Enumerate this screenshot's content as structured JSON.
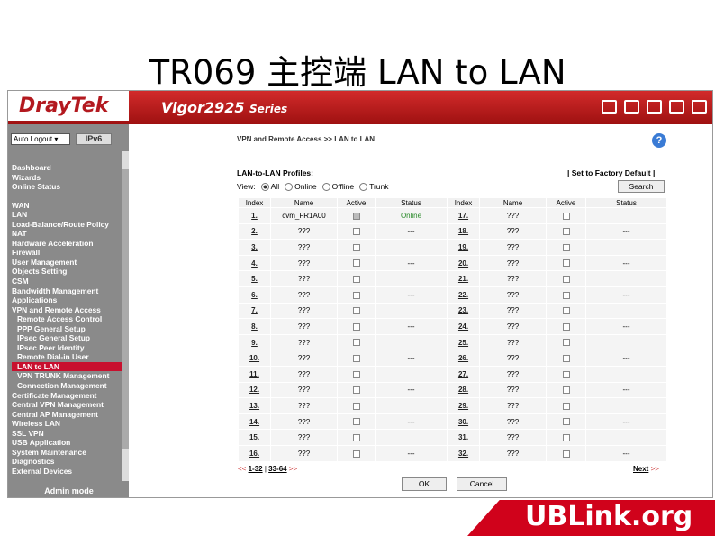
{
  "slide": {
    "title": "TR069 主控端 LAN to LAN"
  },
  "header": {
    "logo": "DrayTek",
    "model": "Vigor2925",
    "series": "Series"
  },
  "sidebar": {
    "auto_logout": "Auto Logout ▾",
    "flag": "IPv6",
    "menu": [
      {
        "label": "Dashboard",
        "sub": false
      },
      {
        "label": "Wizards",
        "sub": false
      },
      {
        "label": "Online Status",
        "sub": false
      },
      {
        "label": "WAN",
        "sub": false,
        "gap": true
      },
      {
        "label": "LAN",
        "sub": false
      },
      {
        "label": "Load-Balance/Route Policy",
        "sub": false
      },
      {
        "label": "NAT",
        "sub": false
      },
      {
        "label": "Hardware Acceleration",
        "sub": false
      },
      {
        "label": "Firewall",
        "sub": false
      },
      {
        "label": "User Management",
        "sub": false
      },
      {
        "label": "Objects Setting",
        "sub": false
      },
      {
        "label": "CSM",
        "sub": false
      },
      {
        "label": "Bandwidth Management",
        "sub": false
      },
      {
        "label": "Applications",
        "sub": false
      },
      {
        "label": "VPN and Remote Access",
        "sub": false
      },
      {
        "label": "Remote Access Control",
        "sub": true
      },
      {
        "label": "PPP General Setup",
        "sub": true
      },
      {
        "label": "IPsec General Setup",
        "sub": true
      },
      {
        "label": "IPsec Peer Identity",
        "sub": true
      },
      {
        "label": "Remote Dial-in User",
        "sub": true
      },
      {
        "label": "LAN to LAN",
        "sub": true,
        "active": true
      },
      {
        "label": "VPN TRUNK Management",
        "sub": true
      },
      {
        "label": "Connection Management",
        "sub": true
      },
      {
        "label": "Certificate Management",
        "sub": false
      },
      {
        "label": "Central VPN Management",
        "sub": false
      },
      {
        "label": "Central AP Management",
        "sub": false
      },
      {
        "label": "Wireless LAN",
        "sub": false
      },
      {
        "label": "SSL VPN",
        "sub": false
      },
      {
        "label": "USB Application",
        "sub": false
      },
      {
        "label": "System Maintenance",
        "sub": false
      },
      {
        "label": "Diagnostics",
        "sub": false
      },
      {
        "label": "External Devices",
        "sub": false
      }
    ],
    "admin_mode": "Admin mode"
  },
  "main": {
    "breadcrumb": "VPN and Remote Access >> LAN to LAN",
    "help": "?",
    "section_title": "LAN-to-LAN Profiles:",
    "factory_default": "Set to Factory Default",
    "view_label": "View:",
    "view_options": [
      "All",
      "Online",
      "Offline",
      "Trunk"
    ],
    "search": "Search",
    "columns": [
      "Index",
      "Name",
      "Active",
      "Status",
      "Index",
      "Name",
      "Active",
      "Status"
    ],
    "rows": [
      {
        "i1": "1.",
        "n1": "cvm_FR1A00",
        "a1": true,
        "s1": "Online",
        "i2": "17.",
        "n2": "???",
        "a2": false,
        "s2": ""
      },
      {
        "i1": "2.",
        "n1": "???",
        "a1": false,
        "s1": "---",
        "i2": "18.",
        "n2": "???",
        "a2": false,
        "s2": "---"
      },
      {
        "i1": "3.",
        "n1": "???",
        "a1": false,
        "s1": "",
        "i2": "19.",
        "n2": "???",
        "a2": false,
        "s2": ""
      },
      {
        "i1": "4.",
        "n1": "???",
        "a1": false,
        "s1": "---",
        "i2": "20.",
        "n2": "???",
        "a2": false,
        "s2": "---"
      },
      {
        "i1": "5.",
        "n1": "???",
        "a1": false,
        "s1": "",
        "i2": "21.",
        "n2": "???",
        "a2": false,
        "s2": ""
      },
      {
        "i1": "6.",
        "n1": "???",
        "a1": false,
        "s1": "---",
        "i2": "22.",
        "n2": "???",
        "a2": false,
        "s2": "---"
      },
      {
        "i1": "7.",
        "n1": "???",
        "a1": false,
        "s1": "",
        "i2": "23.",
        "n2": "???",
        "a2": false,
        "s2": ""
      },
      {
        "i1": "8.",
        "n1": "???",
        "a1": false,
        "s1": "---",
        "i2": "24.",
        "n2": "???",
        "a2": false,
        "s2": "---"
      },
      {
        "i1": "9.",
        "n1": "???",
        "a1": false,
        "s1": "",
        "i2": "25.",
        "n2": "???",
        "a2": false,
        "s2": ""
      },
      {
        "i1": "10.",
        "n1": "???",
        "a1": false,
        "s1": "---",
        "i2": "26.",
        "n2": "???",
        "a2": false,
        "s2": "---"
      },
      {
        "i1": "11.",
        "n1": "???",
        "a1": false,
        "s1": "",
        "i2": "27.",
        "n2": "???",
        "a2": false,
        "s2": ""
      },
      {
        "i1": "12.",
        "n1": "???",
        "a1": false,
        "s1": "---",
        "i2": "28.",
        "n2": "???",
        "a2": false,
        "s2": "---"
      },
      {
        "i1": "13.",
        "n1": "???",
        "a1": false,
        "s1": "",
        "i2": "29.",
        "n2": "???",
        "a2": false,
        "s2": ""
      },
      {
        "i1": "14.",
        "n1": "???",
        "a1": false,
        "s1": "---",
        "i2": "30.",
        "n2": "???",
        "a2": false,
        "s2": "---"
      },
      {
        "i1": "15.",
        "n1": "???",
        "a1": false,
        "s1": "",
        "i2": "31.",
        "n2": "???",
        "a2": false,
        "s2": ""
      },
      {
        "i1": "16.",
        "n1": "???",
        "a1": false,
        "s1": "---",
        "i2": "32.",
        "n2": "???",
        "a2": false,
        "s2": "---"
      }
    ],
    "pager_prev": "<<",
    "pager_page1": "1-32",
    "pager_sep": "|",
    "pager_page2": "33-64",
    "pager_next_arrows": ">>",
    "next_label": "Next",
    "ok": "OK",
    "cancel": "Cancel"
  },
  "brand": {
    "text": "UBLink.org"
  },
  "colors": {
    "header_red": "#c8102e",
    "sidebar_gray": "#8a8a8a",
    "online_green": "#2a8a2a",
    "brand_red": "#d0021b"
  }
}
